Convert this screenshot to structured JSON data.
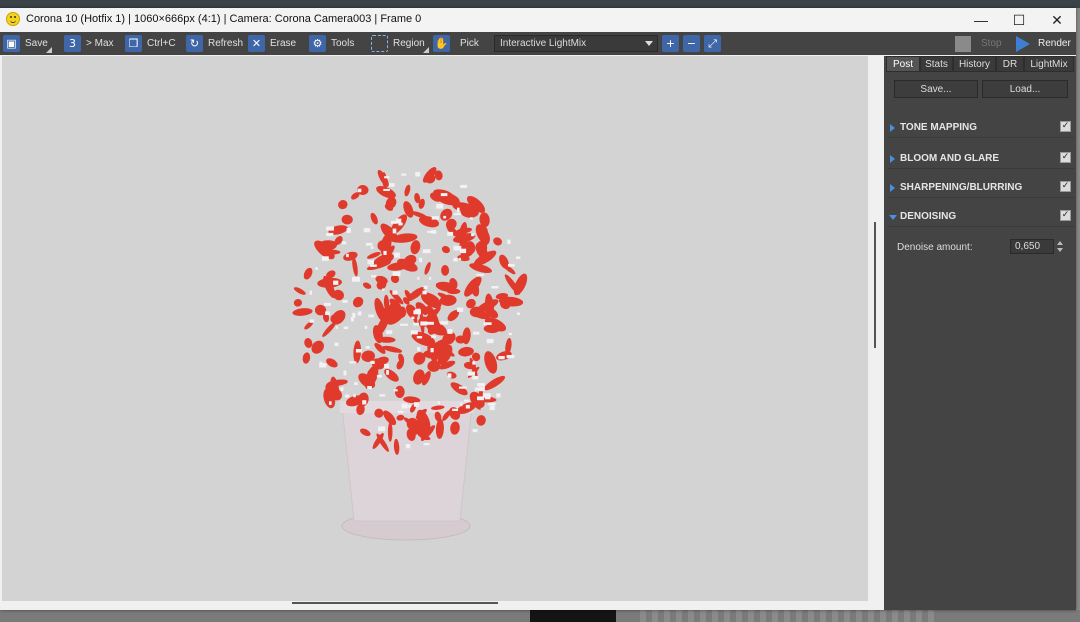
{
  "window": {
    "title": "Corona 10 (Hotfix 1) | 1060×666px (4:1) | Camera: Corona Camera003 | Frame 0",
    "controls": {
      "minimize": "—",
      "maximize": "☐",
      "close": "✕"
    }
  },
  "toolbar": {
    "save_label": "Save",
    "max_label": "> Max",
    "copy_label": "Ctrl+C",
    "refresh_label": "Refresh",
    "erase_label": "Erase",
    "tools_label": "Tools",
    "region_label": "Region",
    "pick_label": "Pick",
    "lightmix_value": "Interactive LightMix",
    "stop_label": "Stop",
    "render_label": "Render",
    "icons": [
      "save-icon",
      "copy-to-max-icon",
      "copy-icon",
      "refresh-icon",
      "erase-icon",
      "tools-icon",
      "region-icon",
      "pick-icon",
      "zoom-in-icon",
      "zoom-out-icon",
      "zoom-fit-icon",
      "stop-icon",
      "render-play-icon"
    ]
  },
  "panel": {
    "tabs": [
      {
        "label": "Post",
        "active": true
      },
      {
        "label": "Stats",
        "active": false
      },
      {
        "label": "History",
        "active": false
      },
      {
        "label": "DR",
        "active": false
      },
      {
        "label": "LightMix",
        "active": false
      }
    ],
    "save_label": "Save...",
    "load_label": "Load...",
    "sections": [
      {
        "label": "TONE MAPPING",
        "expanded": false,
        "enabled": true
      },
      {
        "label": "BLOOM AND GLARE",
        "expanded": false,
        "enabled": true
      },
      {
        "label": "SHARPENING/BLURRING",
        "expanded": false,
        "enabled": true
      },
      {
        "label": "DENOISING",
        "expanded": true,
        "enabled": true
      }
    ],
    "denoise": {
      "label": "Denoise amount:",
      "value": "0,650"
    }
  },
  "colors": {
    "accent": "#3f67a8",
    "panel_bg": "#444444",
    "viewport_bg": "#d3d3d3",
    "plant_red": "#e03a2c"
  }
}
